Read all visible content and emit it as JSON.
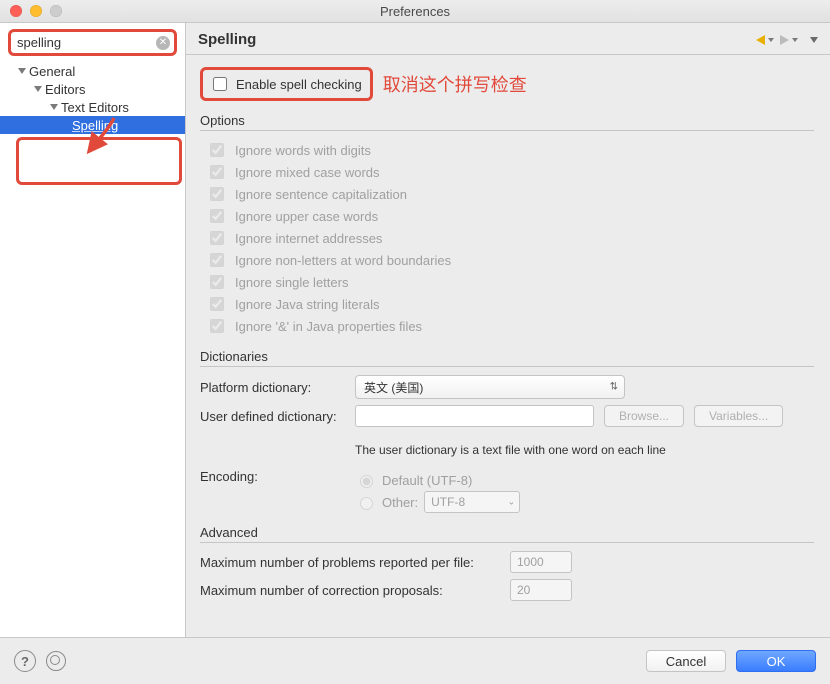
{
  "window": {
    "title": "Preferences"
  },
  "search": {
    "value": "spelling"
  },
  "tree": {
    "items": [
      {
        "label": "General"
      },
      {
        "label": "Editors"
      },
      {
        "label": "Text Editors"
      },
      {
        "label": "Spelling"
      }
    ]
  },
  "page": {
    "title": "Spelling",
    "enable_label": "Enable spell checking",
    "enable_checked": false,
    "annotation": "取消这个拼写检查"
  },
  "options": {
    "group_title": "Options",
    "items": [
      {
        "label": "Ignore words with digits",
        "checked": true
      },
      {
        "label": "Ignore mixed case words",
        "checked": true
      },
      {
        "label": "Ignore sentence capitalization",
        "checked": true
      },
      {
        "label": "Ignore upper case words",
        "checked": true
      },
      {
        "label": "Ignore internet addresses",
        "checked": true
      },
      {
        "label": "Ignore non-letters at word boundaries",
        "checked": true
      },
      {
        "label": "Ignore single letters",
        "checked": true
      },
      {
        "label": "Ignore Java string literals",
        "checked": true
      },
      {
        "label": "Ignore '&' in Java properties files",
        "checked": true
      }
    ]
  },
  "dictionaries": {
    "group_title": "Dictionaries",
    "platform_label": "Platform dictionary:",
    "platform_value": "英文 (美国)",
    "user_label": "User defined dictionary:",
    "user_value": "",
    "browse": "Browse...",
    "variables": "Variables...",
    "hint": "The user dictionary is a text file with one word on each line",
    "encoding_label": "Encoding:",
    "encoding_default_label": "Default (UTF-8)",
    "encoding_other_label": "Other:",
    "encoding_other_value": "UTF-8",
    "encoding_selected": "default"
  },
  "advanced": {
    "group_title": "Advanced",
    "max_problems_label": "Maximum number of problems reported per file:",
    "max_problems_value": "1000",
    "max_proposals_label": "Maximum number of correction proposals:",
    "max_proposals_value": "20"
  },
  "footer": {
    "cancel": "Cancel",
    "ok": "OK"
  }
}
